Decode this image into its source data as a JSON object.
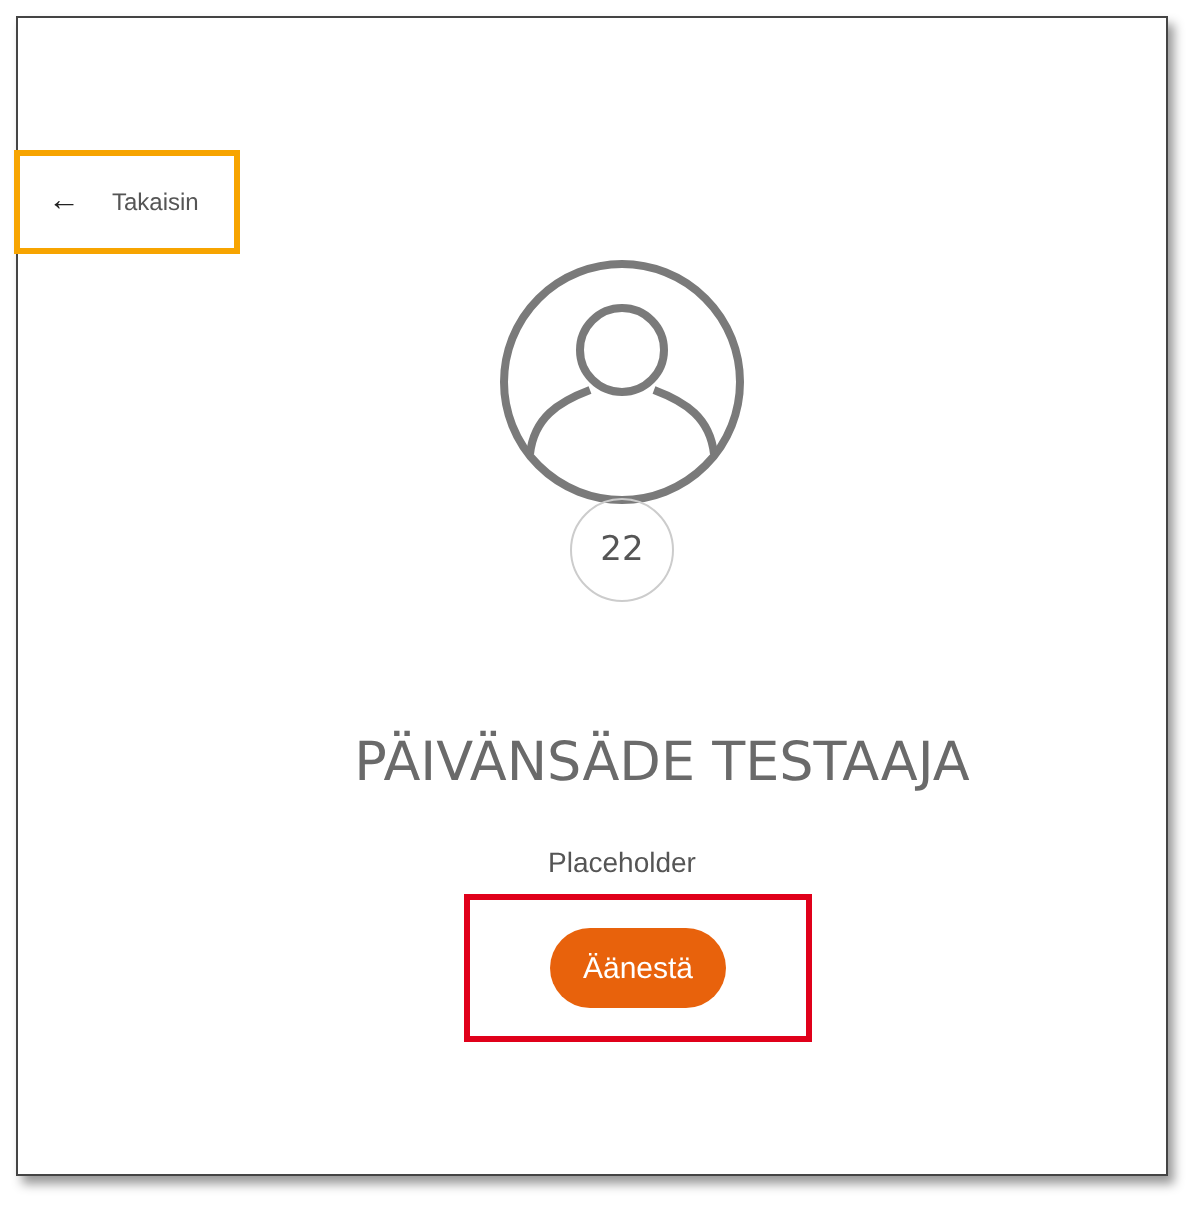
{
  "back_button": {
    "icon": "←",
    "label": "Takaisin",
    "highlight": {
      "color": "#f7a400"
    }
  },
  "profile": {
    "number": "22",
    "name": "PÄIVÄNSÄDE TESTAAJA",
    "subtitle": "Placeholder"
  },
  "vote_button": {
    "label": "Äänestä",
    "highlight": {
      "color": "#e0001a"
    }
  }
}
